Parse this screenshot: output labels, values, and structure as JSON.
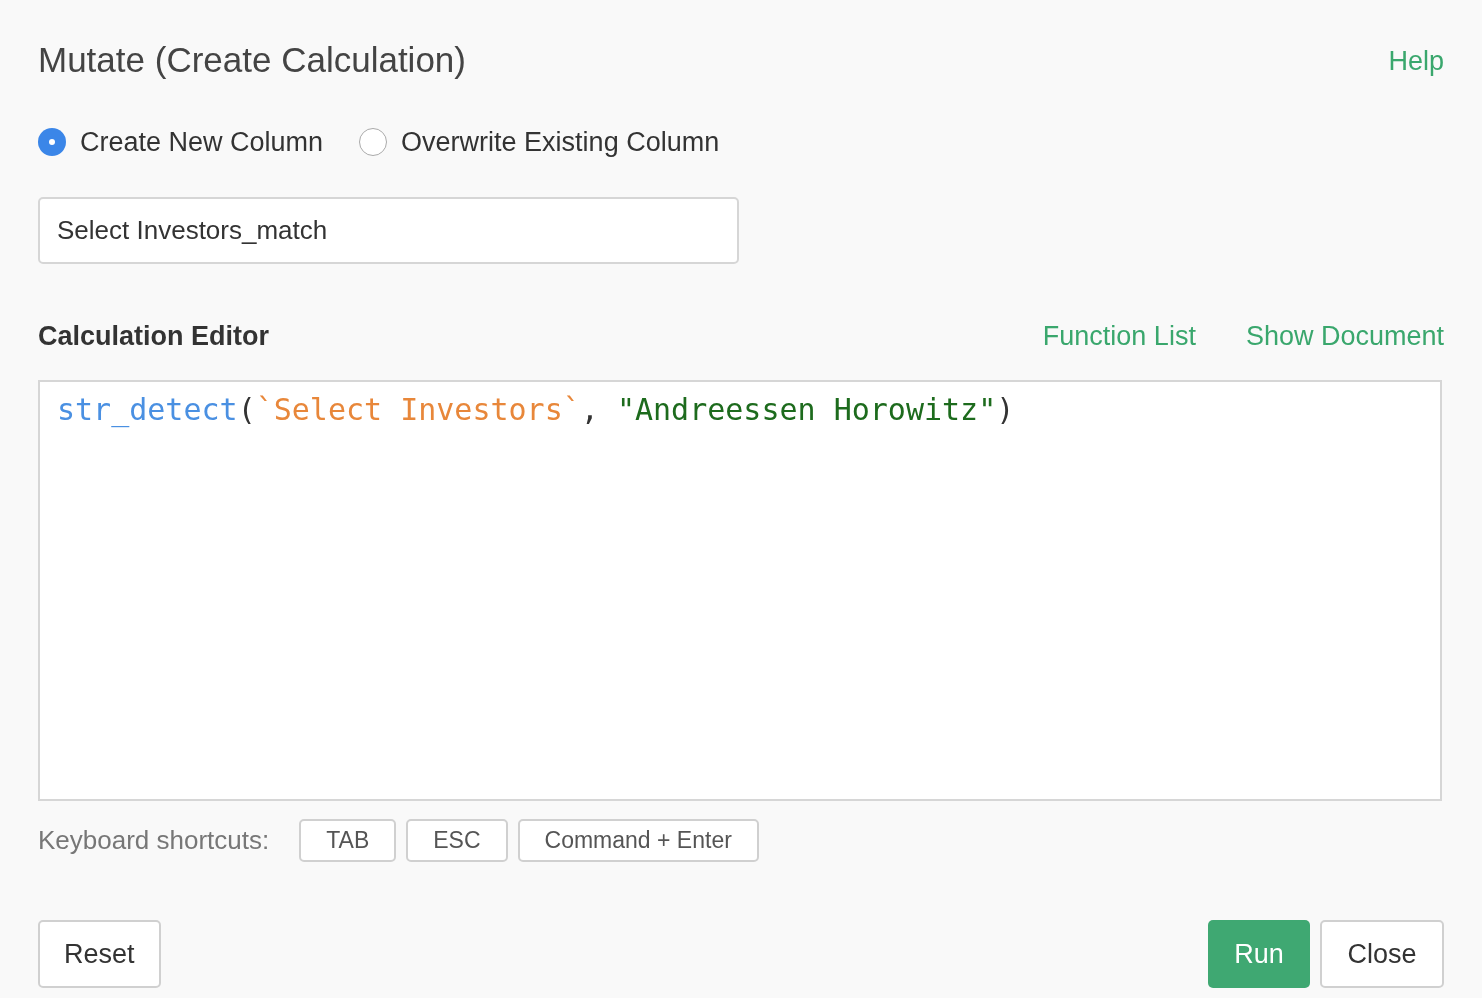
{
  "title": "Mutate (Create Calculation)",
  "help_link": "Help",
  "column_mode": [
    {
      "label": "Create New Column",
      "selected": true
    },
    {
      "label": "Overwrite Existing Column",
      "selected": false
    }
  ],
  "column_name": {
    "value": "Select Investors_match"
  },
  "editor": {
    "label": "Calculation Editor",
    "links": [
      "Function List",
      "Show Document"
    ],
    "code": [
      {
        "kind": "function",
        "text": "str_detect"
      },
      {
        "kind": "punct",
        "text": "("
      },
      {
        "kind": "column",
        "text": "`Select Investors`"
      },
      {
        "kind": "punct",
        "text": ", "
      },
      {
        "kind": "string",
        "text": "\"Andreessen Horowitz\""
      },
      {
        "kind": "punct",
        "text": ")"
      }
    ]
  },
  "shortcuts": {
    "label": "Keyboard shortcuts:",
    "keys": [
      "TAB",
      "ESC",
      "Command + Enter"
    ]
  },
  "buttons": {
    "reset": "Reset",
    "run": "Run",
    "close": "Close"
  }
}
